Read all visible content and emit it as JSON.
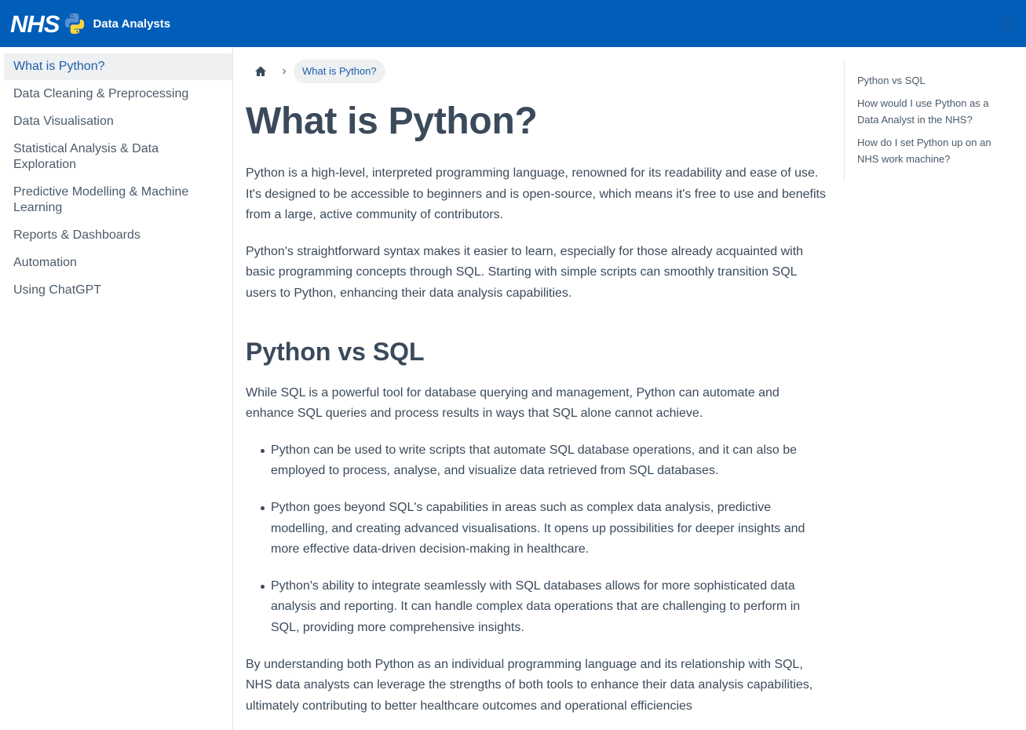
{
  "header": {
    "logo_text": "NHS",
    "title": "Data Analysts",
    "theme_icon": "sun-icon"
  },
  "sidebar": {
    "items": [
      {
        "label": "What is Python?",
        "active": true
      },
      {
        "label": "Data Cleaning & Preprocessing"
      },
      {
        "label": "Data Visualisation"
      },
      {
        "label": "Statistical Analysis & Data Exploration"
      },
      {
        "label": "Predictive Modelling & Machine Learning"
      },
      {
        "label": "Reports & Dashboards"
      },
      {
        "label": "Automation"
      },
      {
        "label": "Using ChatGPT"
      }
    ]
  },
  "breadcrumb": {
    "home_icon": "home-icon",
    "separator_icon": "chevron-right-icon",
    "current": "What is Python?"
  },
  "content": {
    "title": "What is Python?",
    "intro_paragraphs": [
      "Python is a high-level, interpreted programming language, renowned for its readability and ease of use. It's designed to be accessible to beginners and is open-source, which means it's free to use and benefits from a large, active community of contributors.",
      "Python's straightforward syntax makes it easier to learn, especially for those already acquainted with basic programming concepts through SQL. Starting with simple scripts can smoothly transition SQL users to Python, enhancing their data analysis capabilities."
    ],
    "section_title": "Python vs SQL",
    "section_intro": "While SQL is a powerful tool for database querying and management, Python can automate and enhance SQL queries and process results in ways that SQL alone cannot achieve.",
    "bullets": [
      "Python can be used to write scripts that automate SQL database operations, and it can also be employed to process, analyse, and visualize data retrieved from SQL databases.",
      "Python goes beyond SQL's capabilities in areas such as complex data analysis, predictive modelling, and creating advanced visualisations. It opens up possibilities for deeper insights and more effective data-driven decision-making in healthcare.",
      "Python's ability to integrate seamlessly with SQL databases allows for more sophisticated data analysis and reporting. It can handle complex data operations that are challenging to perform in SQL, providing more comprehensive insights."
    ],
    "closing_paragraph": "By understanding both Python as an individual programming language and its relationship with SQL, NHS data analysts can leverage the strengths of both tools to enhance their data analysis capabilities, ultimately contributing to better healthcare outcomes and operational efficiencies"
  },
  "toc": {
    "items": [
      "Python vs SQL",
      "How would I use Python as a Data Analyst in the NHS?",
      "How do I set Python up on an NHS work machine?"
    ]
  },
  "colors": {
    "header_bg": "#005eb8",
    "text": "#3b4a5b",
    "link_active": "#1c5ea8"
  }
}
